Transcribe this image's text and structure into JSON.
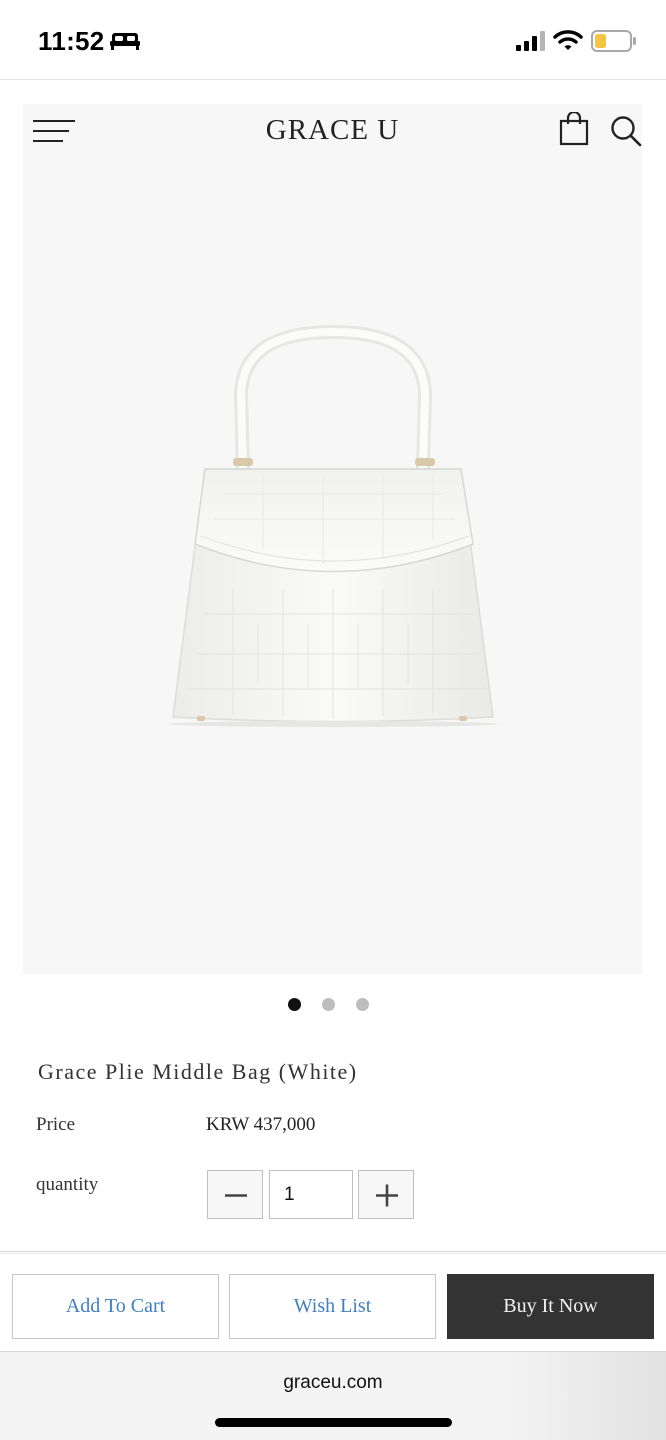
{
  "status_bar": {
    "time": "11:52",
    "icons": [
      "bed-icon",
      "signal-icon",
      "wifi-icon",
      "battery-icon"
    ],
    "battery_color": "#f4c542"
  },
  "header": {
    "brand": "GRACE U",
    "icons": [
      "menu-icon",
      "shopping-bag-icon",
      "search-icon"
    ]
  },
  "gallery": {
    "slide_count": 3,
    "active_slide": 1
  },
  "product": {
    "name": "Grace Plie Middle Bag (White)",
    "price_label": "Price",
    "price_value": "KRW 437,000",
    "quantity_label": "quantity",
    "quantity_value": "1"
  },
  "actions": {
    "add_to_cart": "Add To Cart",
    "wish_list": "Wish List",
    "buy_now": "Buy It Now"
  },
  "browser": {
    "url": "graceu.com"
  },
  "colors": {
    "link_blue": "#3f7fc2",
    "buy_button_bg": "#333333"
  }
}
